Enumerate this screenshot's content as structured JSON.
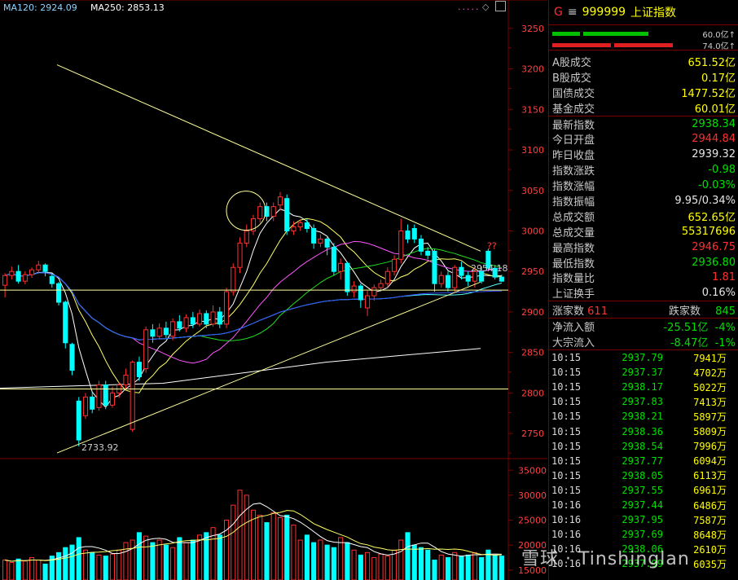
{
  "chart_header": {
    "ma120_label": "MA120: 2924.09",
    "ma250_label": "MA250: 2853.13",
    "dots": "....."
  },
  "colors": {
    "up": "#ff3030",
    "down": "#00ffff",
    "green": "#00e000",
    "yellow": "#ffff00",
    "axis_red": "#7a0000"
  },
  "chart_data": {
    "type": "candlestick",
    "y_axis_ticks": [
      "3250",
      "3200",
      "3150",
      "3100",
      "3050",
      "3000",
      "2950",
      "2900",
      "2850",
      "2800",
      "2750"
    ],
    "volume_axis_ticks": [
      "35000",
      "30000",
      "25000",
      "20000",
      "15000"
    ],
    "annotations": {
      "low_label": "2733.92",
      "last_label": "2954.18",
      "question_marks": "??"
    },
    "ylim": [
      2720,
      3285
    ],
    "volume_ylim": [
      13000,
      37000
    ],
    "candles": [
      {
        "o": 2933,
        "c": 2945,
        "h": 2948,
        "l": 2918
      },
      {
        "o": 2945,
        "c": 2950,
        "h": 2956,
        "l": 2940
      },
      {
        "o": 2950,
        "c": 2938,
        "h": 2958,
        "l": 2935
      },
      {
        "o": 2938,
        "c": 2946,
        "h": 2950,
        "l": 2934
      },
      {
        "o": 2946,
        "c": 2952,
        "h": 2955,
        "l": 2942
      },
      {
        "o": 2952,
        "c": 2958,
        "h": 2963,
        "l": 2948
      },
      {
        "o": 2958,
        "c": 2950,
        "h": 2960,
        "l": 2944
      },
      {
        "o": 2944,
        "c": 2935,
        "h": 2947,
        "l": 2930
      },
      {
        "o": 2935,
        "c": 2912,
        "h": 2937,
        "l": 2908
      },
      {
        "o": 2912,
        "c": 2862,
        "h": 2914,
        "l": 2855
      },
      {
        "o": 2860,
        "c": 2828,
        "h": 2862,
        "l": 2822
      },
      {
        "o": 2790,
        "c": 2742,
        "h": 2795,
        "l": 2734
      },
      {
        "o": 2772,
        "c": 2795,
        "h": 2800,
        "l": 2768
      },
      {
        "o": 2795,
        "c": 2780,
        "h": 2802,
        "l": 2775
      },
      {
        "o": 2782,
        "c": 2810,
        "h": 2815,
        "l": 2778
      },
      {
        "o": 2810,
        "c": 2785,
        "h": 2815,
        "l": 2780
      },
      {
        "o": 2785,
        "c": 2800,
        "h": 2808,
        "l": 2782
      },
      {
        "o": 2800,
        "c": 2810,
        "h": 2813,
        "l": 2794
      },
      {
        "o": 2810,
        "c": 2822,
        "h": 2830,
        "l": 2805
      },
      {
        "o": 2755,
        "c": 2838,
        "h": 2840,
        "l": 2752
      },
      {
        "o": 2838,
        "c": 2820,
        "h": 2845,
        "l": 2815
      },
      {
        "o": 2830,
        "c": 2878,
        "h": 2882,
        "l": 2825
      },
      {
        "o": 2878,
        "c": 2870,
        "h": 2885,
        "l": 2862
      },
      {
        "o": 2870,
        "c": 2880,
        "h": 2886,
        "l": 2866
      },
      {
        "o": 2880,
        "c": 2872,
        "h": 2888,
        "l": 2868
      },
      {
        "o": 2870,
        "c": 2888,
        "h": 2892,
        "l": 2865
      },
      {
        "o": 2888,
        "c": 2880,
        "h": 2896,
        "l": 2876
      },
      {
        "o": 2880,
        "c": 2893,
        "h": 2897,
        "l": 2875
      },
      {
        "o": 2893,
        "c": 2885,
        "h": 2900,
        "l": 2880
      },
      {
        "o": 2885,
        "c": 2898,
        "h": 2903,
        "l": 2882
      },
      {
        "o": 2898,
        "c": 2885,
        "h": 2902,
        "l": 2880
      },
      {
        "o": 2885,
        "c": 2900,
        "h": 2908,
        "l": 2882
      },
      {
        "o": 2900,
        "c": 2885,
        "h": 2906,
        "l": 2880
      },
      {
        "o": 2885,
        "c": 2925,
        "h": 2930,
        "l": 2880
      },
      {
        "o": 2925,
        "c": 2955,
        "h": 2960,
        "l": 2920
      },
      {
        "o": 2955,
        "c": 2985,
        "h": 2992,
        "l": 2948
      },
      {
        "o": 2985,
        "c": 3000,
        "h": 3008,
        "l": 2980
      },
      {
        "o": 3000,
        "c": 3015,
        "h": 3020,
        "l": 2995
      },
      {
        "o": 3015,
        "c": 3030,
        "h": 3035,
        "l": 3010
      },
      {
        "o": 3030,
        "c": 3018,
        "h": 3035,
        "l": 3012
      },
      {
        "o": 3018,
        "c": 3030,
        "h": 3035,
        "l": 3012
      },
      {
        "o": 3032,
        "c": 3042,
        "h": 3048,
        "l": 3025
      },
      {
        "o": 3040,
        "c": 3000,
        "h": 3045,
        "l": 2995
      },
      {
        "o": 3000,
        "c": 3005,
        "h": 3012,
        "l": 2995
      },
      {
        "o": 3005,
        "c": 3010,
        "h": 3014,
        "l": 3000
      },
      {
        "o": 3010,
        "c": 3003,
        "h": 3015,
        "l": 2998
      },
      {
        "o": 3003,
        "c": 2985,
        "h": 3008,
        "l": 2978
      },
      {
        "o": 2985,
        "c": 2990,
        "h": 2996,
        "l": 2980
      },
      {
        "o": 2990,
        "c": 2980,
        "h": 2994,
        "l": 2970
      },
      {
        "o": 2980,
        "c": 2950,
        "h": 2985,
        "l": 2945
      },
      {
        "o": 2950,
        "c": 2960,
        "h": 2966,
        "l": 2940
      },
      {
        "o": 2960,
        "c": 2925,
        "h": 2962,
        "l": 2920
      },
      {
        "o": 2925,
        "c": 2932,
        "h": 2938,
        "l": 2918
      },
      {
        "o": 2932,
        "c": 2915,
        "h": 2935,
        "l": 2905
      },
      {
        "o": 2905,
        "c": 2920,
        "h": 2926,
        "l": 2895
      },
      {
        "o": 2920,
        "c": 2930,
        "h": 2934,
        "l": 2914
      },
      {
        "o": 2930,
        "c": 2935,
        "h": 2940,
        "l": 2925
      },
      {
        "o": 2935,
        "c": 2950,
        "h": 2955,
        "l": 2930
      },
      {
        "o": 2950,
        "c": 2965,
        "h": 2970,
        "l": 2945
      },
      {
        "o": 2965,
        "c": 3000,
        "h": 3015,
        "l": 2960
      },
      {
        "o": 3000,
        "c": 2990,
        "h": 3008,
        "l": 2985
      },
      {
        "o": 3003,
        "c": 2990,
        "h": 3008,
        "l": 2985
      },
      {
        "o": 2990,
        "c": 2975,
        "h": 2995,
        "l": 2970
      },
      {
        "o": 2975,
        "c": 2970,
        "h": 2980,
        "l": 2965
      },
      {
        "o": 2975,
        "c": 2935,
        "h": 2978,
        "l": 2925
      },
      {
        "o": 2935,
        "c": 2945,
        "h": 2950,
        "l": 2930
      },
      {
        "o": 2945,
        "c": 2930,
        "h": 2950,
        "l": 2925
      },
      {
        "o": 2930,
        "c": 2955,
        "h": 2958,
        "l": 2925
      },
      {
        "o": 2955,
        "c": 2945,
        "h": 2962,
        "l": 2940
      },
      {
        "o": 2945,
        "c": 2938,
        "h": 2950,
        "l": 2932
      },
      {
        "o": 2938,
        "c": 2950,
        "h": 2955,
        "l": 2930
      },
      {
        "o": 2950,
        "c": 2938,
        "h": 2956,
        "l": 2935
      },
      {
        "o": 2975,
        "c": 2954,
        "h": 2978,
        "l": 2950
      },
      {
        "o": 2954,
        "c": 2943,
        "h": 2958,
        "l": 2940
      },
      {
        "o": 2943,
        "c": 2938,
        "h": 2946,
        "l": 2937
      }
    ],
    "volumes": [
      17000,
      16500,
      17200,
      16800,
      17500,
      17000,
      16200,
      17800,
      18500,
      19500,
      20000,
      21500,
      19000,
      18500,
      18000,
      17800,
      18200,
      19000,
      20500,
      21000,
      22500,
      21800,
      20500,
      21000,
      20000,
      19500,
      21500,
      20500,
      21000,
      22000,
      22500,
      23500,
      22000,
      25000,
      28000,
      31000,
      30000,
      27000,
      26000,
      24500,
      26500,
      25500,
      26000,
      24000,
      21000,
      22000,
      20500,
      21000,
      20000,
      19500,
      21500,
      20500,
      19000,
      18000,
      18500,
      17500,
      18200,
      17800,
      19000,
      21000,
      22500,
      20000,
      19500,
      19000,
      17000,
      18000,
      17500,
      18500,
      17800,
      18000,
      18500,
      17500,
      19000,
      18000,
      17800
    ]
  },
  "panel": {
    "header": {
      "code_letter": "G",
      "menu_icon": "≡",
      "code": "999999",
      "name": "上证指数"
    },
    "bars": [
      {
        "label": "60.0亿↑"
      },
      {
        "label": "74.0亿↑"
      }
    ],
    "market_rows": [
      {
        "label": "A股成交",
        "value": "651.52亿"
      },
      {
        "label": "B股成交",
        "value": "0.17亿"
      },
      {
        "label": "国债成交",
        "value": "1477.52亿"
      },
      {
        "label": "基金成交",
        "value": "60.01亿"
      }
    ],
    "index_rows": [
      {
        "label": "最新指数",
        "value": "2938.34",
        "color": "#00e000"
      },
      {
        "label": "今日开盘",
        "value": "2944.84",
        "color": "#ff3030"
      },
      {
        "label": "昨日收盘",
        "value": "2939.32",
        "color": "#e6e6e6"
      },
      {
        "label": "指数涨跌",
        "value": "-0.98",
        "color": "#00e000"
      },
      {
        "label": "指数涨幅",
        "value": "-0.03%",
        "color": "#00e000"
      },
      {
        "label": "指数振幅",
        "value": "9.95/0.34%",
        "color": "#e6e6e6"
      },
      {
        "label": "总成交额",
        "value": "652.65亿",
        "color": "#ffff00"
      },
      {
        "label": "总成交量",
        "value": "55317696",
        "color": "#ffff00"
      },
      {
        "label": "最高指数",
        "value": "2946.75",
        "color": "#ff3030"
      },
      {
        "label": "最低指数",
        "value": "2936.80",
        "color": "#00e000"
      },
      {
        "label": "指数量比",
        "value": "1.81",
        "color": "#ff3030"
      },
      {
        "label": "上证换手",
        "value": "0.16%",
        "color": "#e6e6e6"
      }
    ],
    "breadth": {
      "up_label": "涨家数",
      "up_value": "611",
      "down_label": "跌家数",
      "down_value": "845"
    },
    "flows": [
      {
        "label": "净流入额",
        "value": "-25.51亿",
        "pct": "-4%"
      },
      {
        "label": "大宗流入",
        "value": "-8.47亿",
        "pct": "-1%"
      }
    ],
    "ticks": [
      {
        "time": "10:15",
        "price": "2937.79",
        "vol": "7941万"
      },
      {
        "time": "10:15",
        "price": "2937.37",
        "vol": "4702万"
      },
      {
        "time": "10:15",
        "price": "2938.17",
        "vol": "5022万"
      },
      {
        "time": "10:15",
        "price": "2937.83",
        "vol": "7413万"
      },
      {
        "time": "10:15",
        "price": "2938.21",
        "vol": "5897万"
      },
      {
        "time": "10:15",
        "price": "2938.36",
        "vol": "5809万"
      },
      {
        "time": "10:15",
        "price": "2938.54",
        "vol": "7996万"
      },
      {
        "time": "10:15",
        "price": "2937.77",
        "vol": "6094万"
      },
      {
        "time": "10:15",
        "price": "2938.05",
        "vol": "6113万"
      },
      {
        "time": "10:15",
        "price": "2937.55",
        "vol": "6961万"
      },
      {
        "time": "10:16",
        "price": "2937.44",
        "vol": "6486万"
      },
      {
        "time": "10:16",
        "price": "2937.95",
        "vol": "7587万"
      },
      {
        "time": "10:16",
        "price": "2937.69",
        "vol": "8648万"
      },
      {
        "time": "10:16",
        "price": "2938.06",
        "vol": "2610万"
      },
      {
        "time": "10:16",
        "price": "2937.99",
        "vol": "6035万"
      }
    ]
  },
  "watermark": "雪球 · Tinshinglan"
}
